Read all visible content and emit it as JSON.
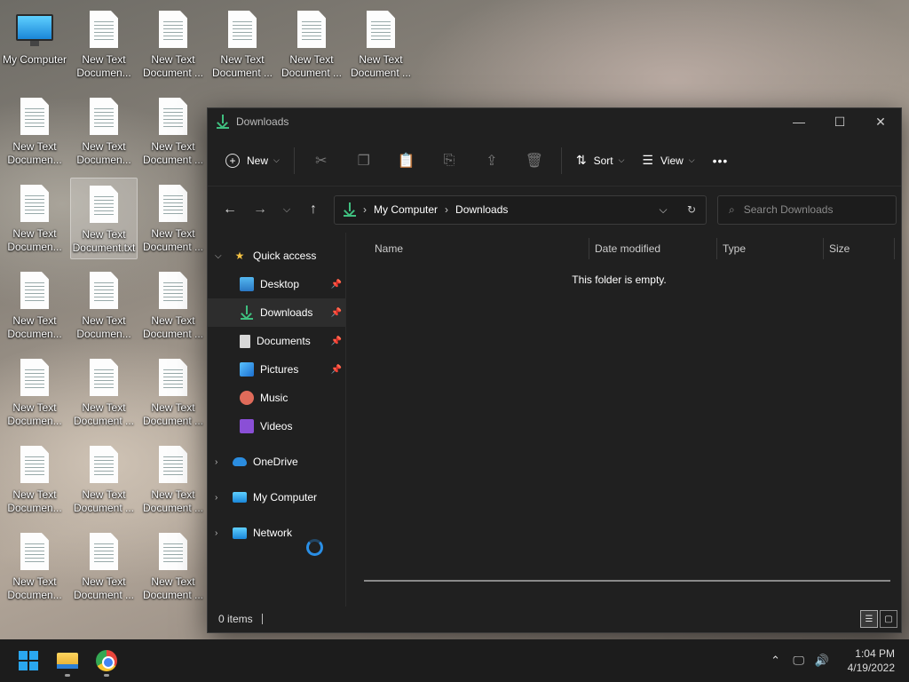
{
  "desktop": {
    "my_computer_label": "My Computer",
    "icons": [
      "New Text\nDocumen...",
      "New Text\nDocument ...",
      "New Text\nDocument ...",
      "New Text\nDocument ...",
      "New Text\nDocument ...",
      "New Text\nDocumen...",
      "New Text\nDocumen...",
      "New Text\nDocument ...",
      "New Text\nDocumen...",
      "New Text\nDocument.txt",
      "New Text\nDocument ...",
      "New Text\nDocumen...",
      "New Text\nDocumen...",
      "New Text\nDocument ...",
      "New Text\nDocumen...",
      "New Text\nDocument ...",
      "New Text\nDocument ...",
      "New Text\nDocumen...",
      "New Text\nDocument ...",
      "New Text\nDocument ...",
      "New Text\nDocumen...",
      "New Text\nDocument ...",
      "New Text\nDocument ..."
    ]
  },
  "window": {
    "title": "Downloads",
    "controls": {
      "minimize": "—",
      "maximize": "☐",
      "close": "✕"
    }
  },
  "toolbar": {
    "new_label": "New",
    "sort_label": "Sort",
    "view_label": "View",
    "more_label": "•••"
  },
  "address": {
    "crumbs": [
      "My Computer",
      "Downloads"
    ],
    "search_placeholder": "Search Downloads"
  },
  "navpane": {
    "quick_access": "Quick access",
    "items": [
      "Desktop",
      "Downloads",
      "Documents",
      "Pictures",
      "Music",
      "Videos"
    ],
    "onedrive": "OneDrive",
    "my_computer": "My Computer",
    "network": "Network"
  },
  "columns": {
    "name": "Name",
    "date": "Date modified",
    "type": "Type",
    "size": "Size"
  },
  "empty_message": "This folder is empty.",
  "status": {
    "items": "0 items"
  },
  "taskbar": {
    "time": "1:04 PM",
    "date": "4/19/2022"
  },
  "colors": {
    "accent": "#3fbf7f",
    "window_bg": "#202020",
    "taskbar_bg": "#1c1c1c",
    "spinner": "#2a8fe6"
  }
}
